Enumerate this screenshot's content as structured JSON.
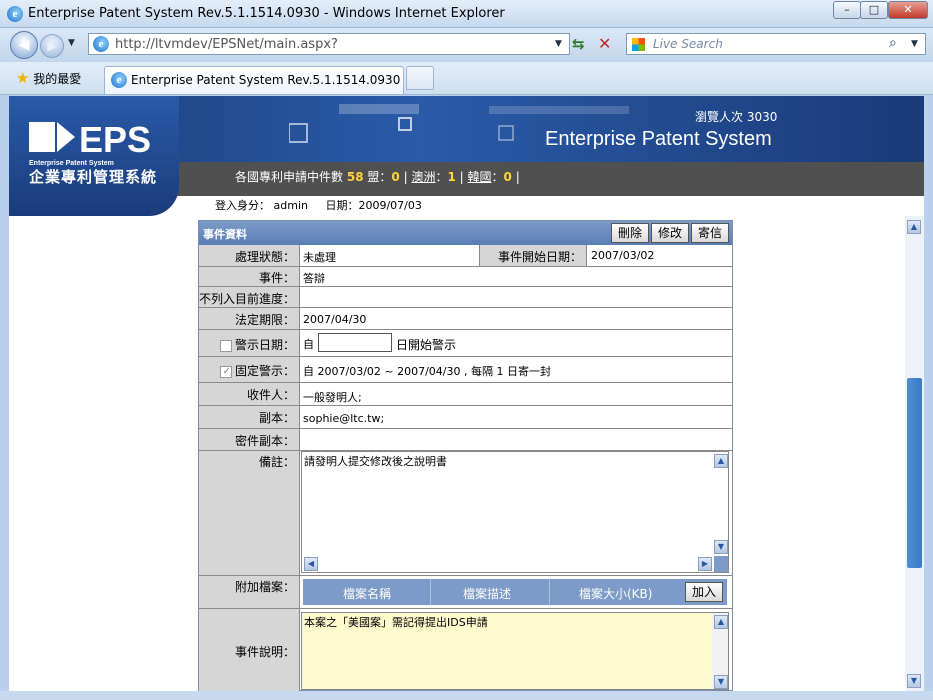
{
  "window": {
    "title": "Enterprise Patent System Rev.5.1.1514.0930 - Windows Internet Explorer",
    "minimize": "–",
    "maximize": "□",
    "close": "✕"
  },
  "navbar": {
    "url": "http://ltvmdev/EPSNet/main.aspx?",
    "search_placeholder": "Live Search"
  },
  "tabs": {
    "favorites": "我的最愛",
    "active_tab": "Enterprise Patent System Rev.5.1.1514.0930"
  },
  "banner": {
    "logo_text": "EPS",
    "logo_subtitle": "Enterprise Patent System",
    "logo_cn": "企業專利管理系統",
    "views_label": "瀏覽人次",
    "views_count": "3030",
    "system_name": "Enterprise Patent System",
    "stats_label": "各國專利申請中件數",
    "stats_count": "58",
    "stats_items": [
      {
        "name": "盟",
        "count": "0"
      },
      {
        "name": "澳洲",
        "count": "1"
      },
      {
        "name": "韓國",
        "count": "0"
      }
    ]
  },
  "login": {
    "user_label": "登入身分：",
    "user": "admin",
    "date_label": "日期：",
    "date": "2009/07/03"
  },
  "form": {
    "title": "事件資料",
    "buttons": {
      "delete": "刪除",
      "edit": "修改",
      "send": "寄信"
    },
    "status_label": "處理狀態：",
    "status_value": "未處理",
    "start_date_label": "事件開始日期：",
    "start_date_value": "2007/03/02",
    "event_label": "事件：",
    "event_value": "答辯",
    "exclude_label": "不列入目前進度：",
    "legal_deadline_label": "法定期限：",
    "legal_deadline_value": "2007/04/30",
    "warn_date_label": "警示日期：",
    "warn_from": "自",
    "warn_suffix": "日開始警示",
    "fixed_warn_label": "固定警示：",
    "fixed_warn_value": "自 2007/03/02 ~ 2007/04/30 , 每隔 1 日寄一封",
    "recipient_label": "收件人：",
    "recipient_value": "一般發明人;",
    "cc_label": "副本：",
    "cc_value": "sophie@ltc.tw;",
    "bcc_label": "密件副本：",
    "note_label": "備註：",
    "note_value": "請發明人提交修改後之說明書",
    "attach_label": "附加檔案：",
    "attach_cols": [
      "檔案名稱",
      "檔案描述",
      "檔案大小(KB)"
    ],
    "attach_add": "加入",
    "desc_label": "事件說明：",
    "desc_value": "本案之「美國案」需記得提出IDS申請"
  }
}
